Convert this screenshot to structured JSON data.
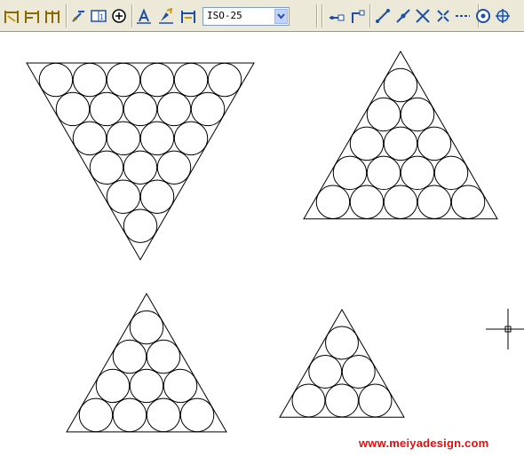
{
  "toolbar": {
    "dimension_style_value": "ISO-25",
    "buttons_left": [
      {
        "name": "quick-dimension-icon",
        "color": "#8a6a00"
      },
      {
        "name": "baseline-dimension-icon",
        "color": "#8a6a00"
      },
      {
        "name": "continue-dimension-icon",
        "color": "#8a6a00"
      },
      {
        "name": "quick-leader-icon",
        "color": "#8a6a00"
      },
      {
        "name": "tolerance-icon",
        "color": "#1d4fa6"
      },
      {
        "name": "center-mark-icon",
        "color": "#000000"
      }
    ],
    "buttons_mid": [
      {
        "name": "dimension-edit-icon",
        "color": "#1d4fa6"
      },
      {
        "name": "dimension-text-edit-icon",
        "color": "#c89a00"
      },
      {
        "name": "dimension-update-icon",
        "color": "#1d4fa6"
      }
    ],
    "buttons_right": [
      {
        "name": "parallel-constraint-icon",
        "color": "#1d4fa6"
      },
      {
        "name": "perpendicular-constraint-icon",
        "color": "#1d4fa6"
      },
      {
        "name": "line-icon",
        "color": "#1d4fa6"
      },
      {
        "name": "extend-line-icon",
        "color": "#1d4fa6"
      },
      {
        "name": "intersection-icon",
        "color": "#1d4fa6"
      },
      {
        "name": "trim-icon",
        "color": "#1d4fa6"
      },
      {
        "name": "dash-line-icon",
        "color": "#1d4fa6"
      },
      {
        "name": "circle-icon",
        "color": "#1d4fa6"
      },
      {
        "name": "orbit-icon",
        "color": "#1d4fa6"
      }
    ]
  },
  "drawing": {
    "triangles": [
      {
        "name": "inverted-triangle-21-circles",
        "orientation": "down",
        "rows": 6
      },
      {
        "name": "upright-triangle-15-circles",
        "orientation": "up",
        "rows": 5
      },
      {
        "name": "upright-triangle-10-circles",
        "orientation": "up",
        "rows": 4
      },
      {
        "name": "upright-triangle-6-circles",
        "orientation": "up",
        "rows": 3
      }
    ],
    "stroke_color": "#000000"
  },
  "watermark": {
    "text": "www.meiyadesign.com",
    "color": "#e01010"
  }
}
